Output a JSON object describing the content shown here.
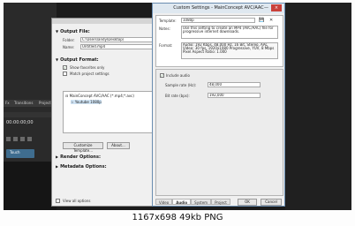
{
  "editor": {
    "tabs": [
      "Fx",
      "Transitions",
      "Project"
    ],
    "timecode": "00:00:00;00",
    "track_name": "Touch"
  },
  "render_dialog": {
    "output_file": {
      "heading": "Output File:",
      "folder_label": "Folder:",
      "folder_value": "C:\\Users\\andy\\Desktop\\",
      "name_label": "Name:",
      "name_value": "Untitled.mp4"
    },
    "output_format": {
      "heading": "Output Format:",
      "show_favorites": "Show favorites only",
      "match_project": "Match project settings",
      "tree_parent": "MainConcept AVC/AAC (*.mp4;*.avc)",
      "tree_child": "Youtube 1080p"
    },
    "customize_button": "Customize Template...",
    "about_button": "About...",
    "render_options": "Render Options:",
    "metadata_options": "Metadata Options:",
    "view_all_options": "View all options"
  },
  "custom_settings": {
    "title": "Custom Settings - MainConcept AVC/AAC",
    "close": "×",
    "minimize": "—",
    "template_label": "Template:",
    "template_value": "1080p",
    "notes_label": "Notes:",
    "notes_value": "Use this setting to create an MP4 (AVC/AAC) file for progressive internet downloads.",
    "format_label": "Format:",
    "format_lines": [
      "Audio: 192 Kbps, 48,000 Hz, 16 Bit, Stereo, AAC",
      "Video: 30 fps, 1920x1080 Progressive, YUV, 8 Mbps",
      "Pixel Aspect Ratio: 1.000"
    ],
    "include_audio": "Include audio",
    "sample_rate_label": "Sample rate (Hz):",
    "sample_rate_value": "48,000",
    "bit_rate_label": "Bit rate (bps):",
    "bit_rate_value": "192,000",
    "tabs": [
      "Video",
      "Audio",
      "System",
      "Project"
    ],
    "active_tab": "Audio",
    "ok": "OK",
    "cancel": "Cancel"
  },
  "footer": "1167x698 49kb PNG"
}
